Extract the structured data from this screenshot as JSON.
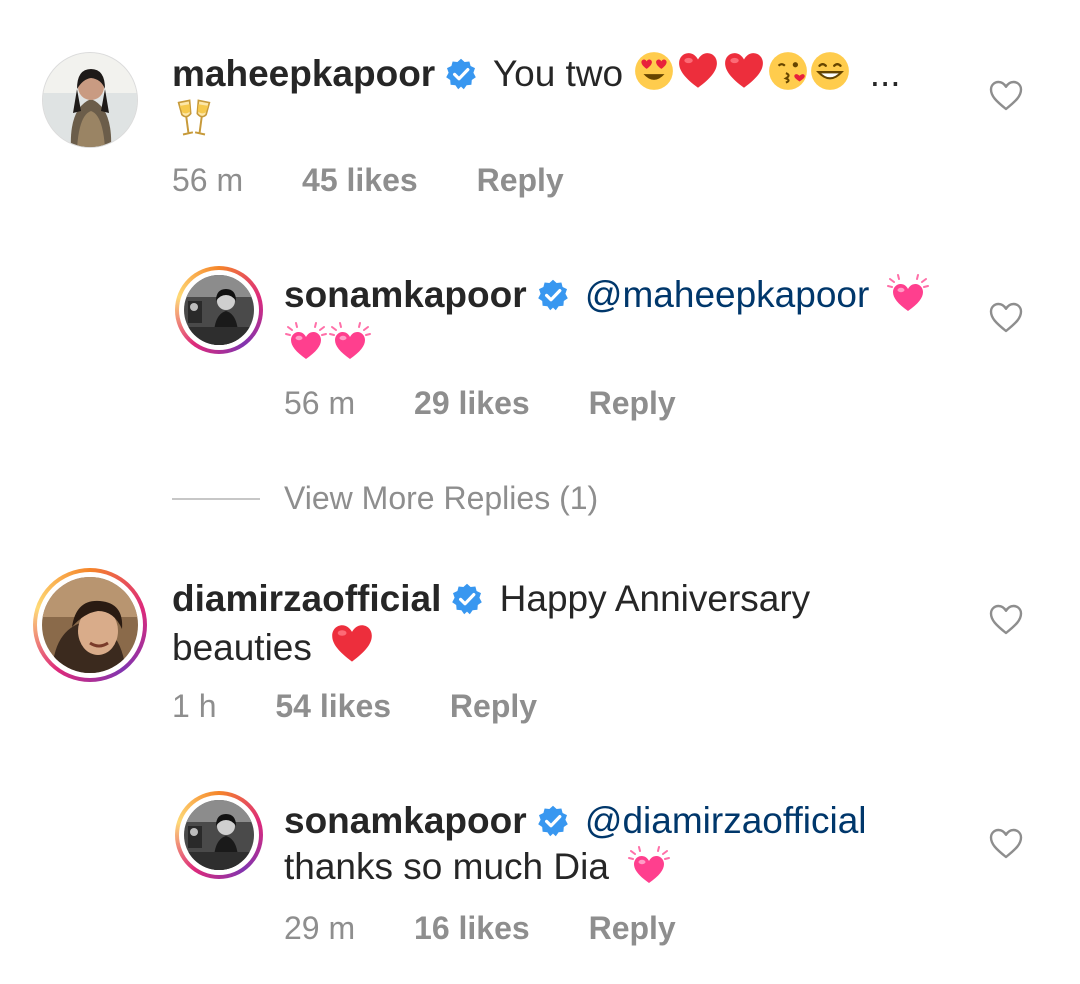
{
  "comments": [
    {
      "username": "maheepkapoor",
      "text": "You two",
      "text_suffix": "...",
      "time": "56 m",
      "likes": "45 likes",
      "reply": "Reply"
    },
    {
      "username": "sonamkapoor",
      "mention": "@maheepkapoor",
      "time": "56 m",
      "likes": "29 likes",
      "reply": "Reply"
    },
    {
      "username": "diamirzaofficial",
      "text": "Happy Anniversary",
      "text_line2": "beauties",
      "time": "1 h",
      "likes": "54 likes",
      "reply": "Reply"
    },
    {
      "username": "sonamkapoor",
      "mention": "@diamirzaofficial",
      "text_line2": "thanks so much Dia",
      "time": "29 m",
      "likes": "16 likes",
      "reply": "Reply"
    }
  ],
  "view_more_replies": "View More Replies (1)",
  "colors": {
    "text": "#262626",
    "meta": "#8e8e8e",
    "mention": "#00376b",
    "verified": "#3897f0",
    "heart_red": "#ed2e3c",
    "heart_pink": "#ff3f8e"
  },
  "icons": [
    "verified-badge-icon",
    "heart-outline-icon",
    "red-heart-emoji",
    "heart-eyes-emoji",
    "kiss-emoji",
    "grin-emoji",
    "clinking-glasses-emoji",
    "growing-heart-emoji"
  ]
}
